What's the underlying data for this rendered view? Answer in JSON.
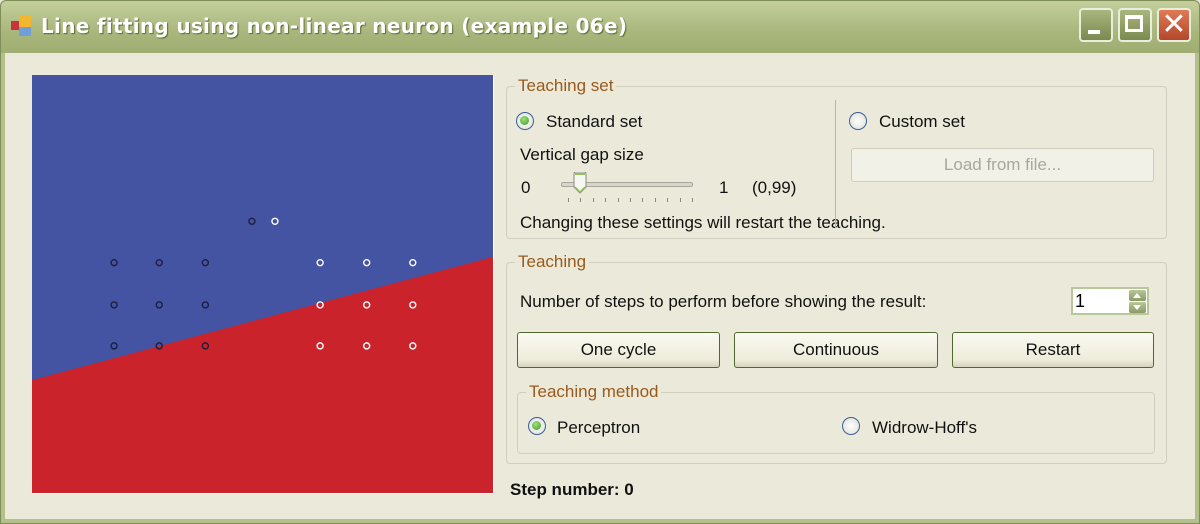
{
  "window": {
    "title": "Line fitting using non-linear neuron (example 06e)",
    "controls": {
      "minimize": "minimize",
      "maximize": "maximize",
      "close": "✕"
    }
  },
  "canvas": {
    "colors": {
      "upper_region": "#4454a2",
      "lower_region": "#ca232b",
      "class_dark": "#1e1e3c",
      "class_light": "#ffffff"
    },
    "decision_line": {
      "left_y_fraction": 0.73,
      "right_y_fraction": 0.435
    },
    "points": [
      {
        "x": 0.477,
        "y": 0.35,
        "class": "dark"
      },
      {
        "x": 0.527,
        "y": 0.35,
        "class": "light"
      },
      {
        "x": 0.178,
        "y": 0.449,
        "class": "dark"
      },
      {
        "x": 0.276,
        "y": 0.449,
        "class": "dark"
      },
      {
        "x": 0.376,
        "y": 0.449,
        "class": "dark"
      },
      {
        "x": 0.625,
        "y": 0.449,
        "class": "light"
      },
      {
        "x": 0.726,
        "y": 0.449,
        "class": "light"
      },
      {
        "x": 0.826,
        "y": 0.449,
        "class": "light"
      },
      {
        "x": 0.178,
        "y": 0.55,
        "class": "dark"
      },
      {
        "x": 0.276,
        "y": 0.55,
        "class": "dark"
      },
      {
        "x": 0.376,
        "y": 0.55,
        "class": "dark"
      },
      {
        "x": 0.625,
        "y": 0.55,
        "class": "light"
      },
      {
        "x": 0.726,
        "y": 0.55,
        "class": "light"
      },
      {
        "x": 0.826,
        "y": 0.55,
        "class": "light"
      },
      {
        "x": 0.178,
        "y": 0.648,
        "class": "dark"
      },
      {
        "x": 0.276,
        "y": 0.648,
        "class": "dark"
      },
      {
        "x": 0.376,
        "y": 0.648,
        "class": "dark"
      },
      {
        "x": 0.625,
        "y": 0.648,
        "class": "light"
      },
      {
        "x": 0.726,
        "y": 0.648,
        "class": "light"
      },
      {
        "x": 0.826,
        "y": 0.648,
        "class": "light"
      }
    ]
  },
  "teaching_set": {
    "label": "Teaching set",
    "standard_set": {
      "label": "Standard set",
      "checked": true
    },
    "custom_set": {
      "label": "Custom set",
      "checked": false
    },
    "load_button": "Load from file...",
    "gap_label": "Vertical gap size",
    "slider": {
      "min_label": "0",
      "max_label": "1",
      "value_label": "(0,99)",
      "value_fraction": 0.1
    },
    "note": "Changing these settings will restart the teaching."
  },
  "teaching": {
    "label": "Teaching",
    "steps_label": "Number of steps to perform before showing the result:",
    "steps_value": "1",
    "buttons": {
      "one_cycle": "One cycle",
      "continuous": "Continuous",
      "restart": "Restart"
    },
    "method": {
      "label": "Teaching method",
      "perceptron": {
        "label": "Perceptron",
        "checked": true
      },
      "widrow_hoff": {
        "label": "Widrow-Hoff's",
        "checked": false
      }
    }
  },
  "status": {
    "step_number": "Step number: 0"
  }
}
